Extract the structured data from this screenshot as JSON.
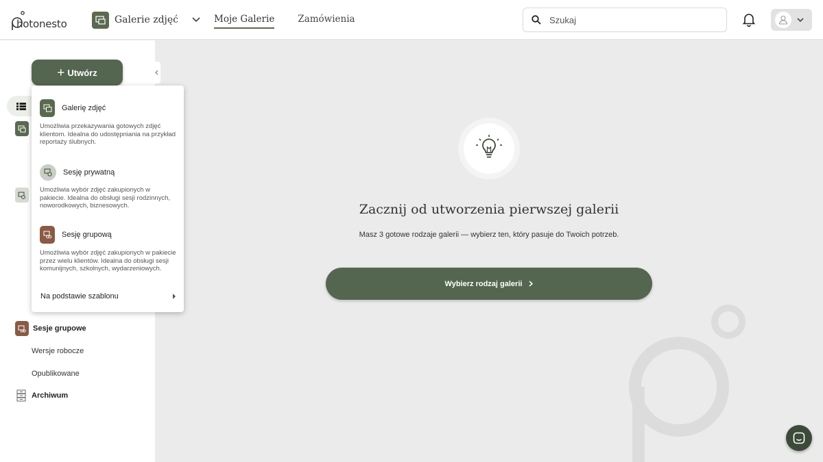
{
  "app": {
    "logo_text": "hotonesto",
    "gallery_switch_label": "Galerie zdjęć"
  },
  "nav": {
    "items": [
      {
        "label": "Moje Galerie",
        "active": true
      },
      {
        "label": "Zamówienia",
        "active": false
      }
    ]
  },
  "search": {
    "placeholder": "Szukaj"
  },
  "sidebar": {
    "create_label": "Utwórz",
    "group_sessions_label": "Sesje grupowe",
    "drafts_label": "Wersje robocze",
    "published_label": "Opublikowane",
    "archive_label": "Archiwum"
  },
  "create_menu": {
    "options": [
      {
        "title": "Galerię zdjęć",
        "description": "Umożliwia przekazywania gotowych zdjęć klientom. Idealna do udostępniania na przykład reportaży ślubnych."
      },
      {
        "title": "Sesję prywatną",
        "description": "Umożliwia wybór zdjęć zakupionych w pakiecie. Idealna do obsługi sesji rodzinnych, noworodkowych, biznesowych."
      },
      {
        "title": "Sesję grupową",
        "description": "Umożliwia wybór zdjęć zakupionych w pakiecie przez wielu klientów. Idealna do obsługi sesji komunijnych, szkolnych, wydarzeniowych."
      }
    ],
    "template_label": "Na podstawie szablonu"
  },
  "main": {
    "title": "Zacznij od utworzenia pierwszej galerii",
    "subtitle": "Masz 3 gotowe rodzaje galerii — wybierz ten, który pasuje do Twoich potrzeb.",
    "cta_label": "Wybierz rodzaj galerii"
  },
  "colors": {
    "accent": "#556650",
    "gallery_icon": "#5a6a4f",
    "private_icon": "#c9cfc4",
    "group_icon": "#8a5a44",
    "background": "#ebebeb"
  }
}
